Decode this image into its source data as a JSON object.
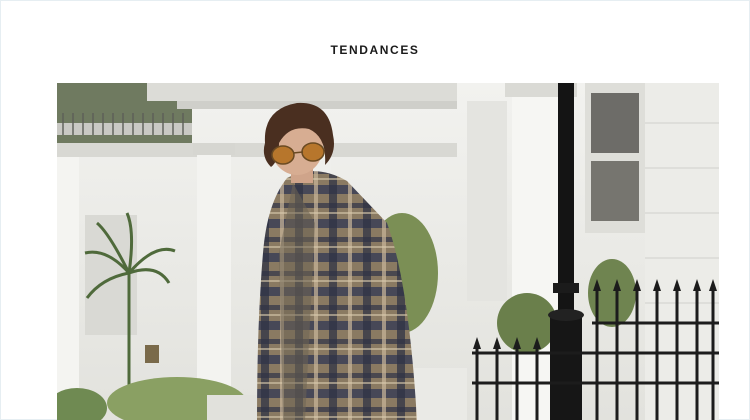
{
  "section": {
    "title": "TENDANCES"
  },
  "photo": {
    "subject": "person-in-plaid-coat"
  }
}
